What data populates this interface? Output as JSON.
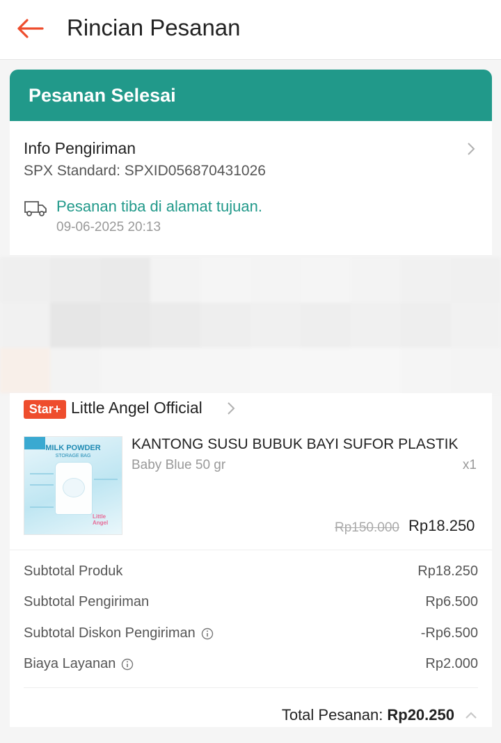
{
  "header": {
    "title": "Rincian Pesanan"
  },
  "status": {
    "label": "Pesanan Selesai",
    "color": "#21998a"
  },
  "shipping": {
    "title": "Info Pengiriman",
    "courier": "SPX Standard: SPXID056870431026",
    "status_text": "Pesanan tiba di alamat tujuan.",
    "status_time": "09-06-2025 20:13"
  },
  "shop": {
    "badge": "Star+",
    "name": "Little Angel Official"
  },
  "product": {
    "image_title": "MILK POWDER",
    "image_subtitle": "STORAGE BAG",
    "image_brand": "Little Angel",
    "name": "KANTONG SUSU BUBUK BAYI SUFOR PLASTIK",
    "variant": "Baby Blue 50 gr",
    "quantity": "x1",
    "price_original": "Rp150.000",
    "price_final": "Rp18.250"
  },
  "summary": {
    "rows": [
      {
        "label": "Subtotal Produk",
        "value": "Rp18.250",
        "info": false
      },
      {
        "label": "Subtotal Pengiriman",
        "value": "Rp6.500",
        "info": false
      },
      {
        "label": "Subtotal Diskon Pengiriman",
        "value": "-Rp6.500",
        "info": true
      },
      {
        "label": "Biaya Layanan",
        "value": "Rp2.000",
        "info": true
      }
    ],
    "total_label": "Total Pesanan:",
    "total_value": "Rp20.250"
  },
  "colors": {
    "accent": "#ee4d2d",
    "teal": "#21998a"
  }
}
